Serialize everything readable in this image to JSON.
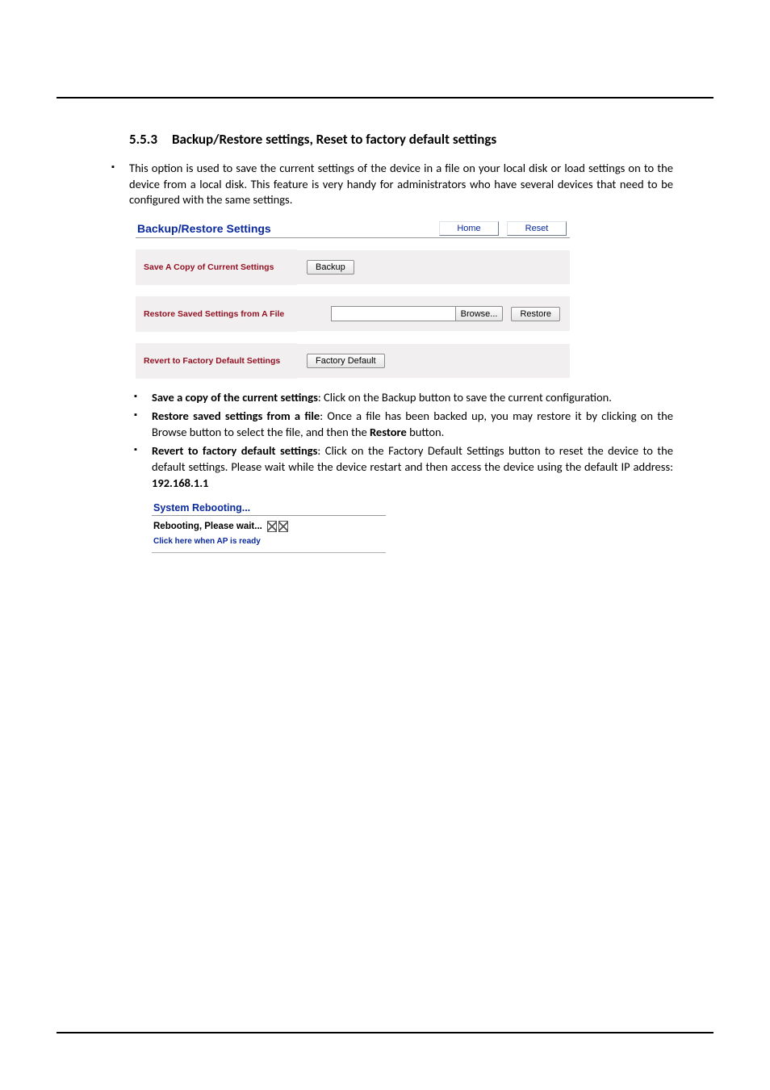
{
  "section": {
    "number": "5.5.3",
    "title": "Backup/Restore settings, Reset to factory default settings"
  },
  "intro_bullet": "This option is used to save the current settings of the device in a file on your local disk or load settings on to the device from a local disk. This feature is very handy for administrators who have several devices that need to be configured with the same settings.",
  "panel": {
    "title": "Backup/Restore Settings",
    "home_btn": "Home",
    "reset_btn": "Reset",
    "rows": {
      "save": {
        "label": "Save A Copy of Current Settings",
        "button": "Backup"
      },
      "restore": {
        "label": "Restore Saved Settings from A File",
        "browse": "Browse...",
        "button": "Restore"
      },
      "revert": {
        "label": "Revert to Factory Default Settings",
        "button": "Factory Default"
      }
    }
  },
  "explain": {
    "save_bold": "Save a copy of the current settings",
    "save_rest": ": Click on the Backup button to save the current configuration.",
    "restore_bold": "Restore saved settings from a file",
    "restore_rest_1": ": Once a file has been backed up, you may restore it by clicking on the Browse button to select the file, and then the ",
    "restore_rest_bold2": "Restore",
    "restore_rest_2": " button.",
    "revert_bold": "Revert to factory default settings",
    "revert_rest_1": ": Click on the Factory Default Settings button to reset the device to the default settings. Please wait while the device restart and then access the device using the default IP address: ",
    "revert_ip": "192.168.1.1"
  },
  "reboot": {
    "title": "System Rebooting...",
    "wait": "Rebooting, Please wait...",
    "link": "Click here when AP is ready"
  }
}
